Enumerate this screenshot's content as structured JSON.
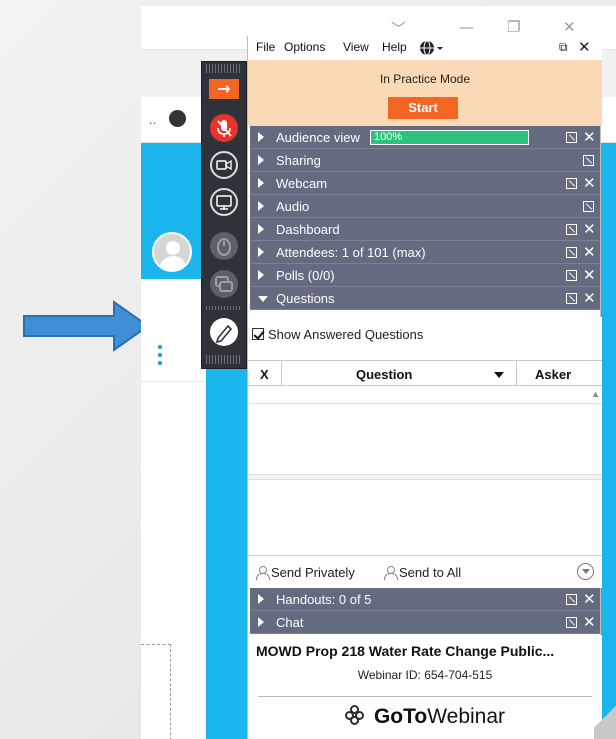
{
  "window_controls": {
    "minimize": "—",
    "restore": "❐",
    "close": "✕",
    "dropdown": "﹀"
  },
  "background": {
    "nav_ellipsis": ".."
  },
  "panel": {
    "menu": {
      "file": "File",
      "options": "Options",
      "view": "View",
      "help": "Help"
    },
    "practice": {
      "status": "In Practice Mode",
      "start_label": "Start"
    },
    "panes": {
      "audience_view": "Audience view",
      "audience_view_percent": "100%",
      "sharing": "Sharing",
      "webcam": "Webcam",
      "audio": "Audio",
      "dashboard": "Dashboard",
      "attendees": "Attendees:  1 of 101 (max)",
      "polls": "Polls (0/0)",
      "questions": "Questions",
      "handouts": "Handouts: 0 of 5",
      "chat": "Chat"
    },
    "questions": {
      "show_answered": "Show Answered Questions",
      "col_x": "X",
      "col_question": "Question",
      "col_asker": "Asker",
      "send_privately": "Send Privately",
      "send_to_all": "Send to All"
    },
    "webinar": {
      "title": "MOWD Prop 218 Water Rate Change Public...",
      "id_text": "Webinar ID: 654-704-515",
      "logo_bold": "GoTo",
      "logo_regular": "Webinar"
    }
  },
  "colors": {
    "accent_orange": "#f26522",
    "pane_header": "#646b80",
    "practice_bg": "#fadab6",
    "progress_green": "#2ec27e",
    "page_blue": "#19b5ec",
    "pointer_blue": "#3f8fd6"
  },
  "icons": {
    "collapse": "arrow-right-icon",
    "mic": "microphone-muted-icon",
    "webcam": "camera-icon",
    "screen": "monitor-icon",
    "handraise": "hand-icon",
    "chat": "chat-bubbles-icon",
    "draw": "pen-icon",
    "language": "globe-icon"
  }
}
